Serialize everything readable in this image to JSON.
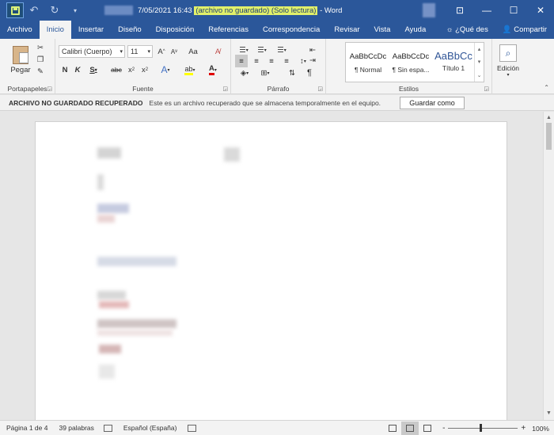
{
  "titlebar": {
    "datetime": "7/05/2021 16:43",
    "status": "(archivo no guardado) (Solo lectura)",
    "separator": "-",
    "app": "Word"
  },
  "tabs": [
    "Archivo",
    "Inicio",
    "Insertar",
    "Diseño",
    "Disposición",
    "Referencias",
    "Correspondencia",
    "Revisar",
    "Vista",
    "Ayuda"
  ],
  "tabs_right": {
    "tell_me": "¿Qué des",
    "share": "Compartir"
  },
  "ribbon": {
    "clipboard": {
      "paste": "Pegar",
      "label": "Portapapeles"
    },
    "font": {
      "label": "Fuente",
      "font_name": "Calibri (Cuerpo)",
      "font_size": "11",
      "grow": "A",
      "shrink": "A",
      "case": "Aa",
      "bold": "N",
      "italic": "K",
      "underline": "S",
      "strike": "abc",
      "subscript": "x",
      "superscript": "x",
      "sub_index": "2",
      "sup_index": "2"
    },
    "paragraph": {
      "label": "Párrafo",
      "marks": "¶"
    },
    "styles": {
      "label": "Estilos",
      "items": [
        {
          "sample": "AaBbCcDc",
          "name": "¶ Normal"
        },
        {
          "sample": "AaBbCcDc",
          "name": "¶ Sin espa..."
        },
        {
          "sample": "AaBbCc",
          "name": "Título 1"
        }
      ]
    },
    "editing": {
      "label": "Edición"
    }
  },
  "message_bar": {
    "title": "ARCHIVO NO GUARDADO RECUPERADO",
    "text": "Este es un archivo recuperado que se almacena temporalmente en el equipo.",
    "button": "Guardar como"
  },
  "status_bar": {
    "page": "Página 1 de 4",
    "words": "39 palabras",
    "language": "Español (España)",
    "zoom": "100%",
    "zoom_minus": "-",
    "zoom_plus": "+"
  },
  "colors": {
    "title_bar": "#2b579a",
    "accent_highlight": "#e1f06a",
    "ribbon_bg": "#f3f3f3",
    "doc_bg": "#e6e6e6"
  }
}
